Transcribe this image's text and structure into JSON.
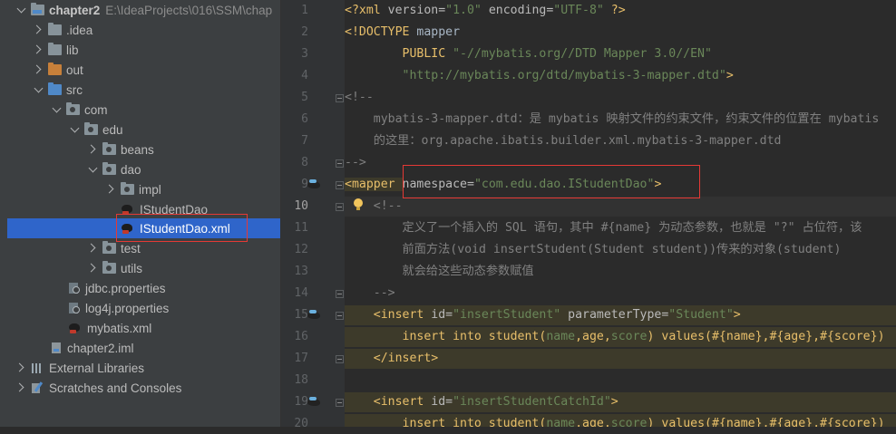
{
  "project_tree": {
    "root": {
      "name": "chapter2",
      "path": "E:\\IdeaProjects\\016\\SSM\\chap"
    },
    "items": [
      {
        "label": ".idea"
      },
      {
        "label": "lib"
      },
      {
        "label": "out"
      },
      {
        "label": "src"
      },
      {
        "label": "com"
      },
      {
        "label": "edu"
      },
      {
        "label": "beans"
      },
      {
        "label": "dao"
      },
      {
        "label": "impl"
      },
      {
        "label": "IStudentDao"
      },
      {
        "label": "IStudentDao.xml"
      },
      {
        "label": "test"
      },
      {
        "label": "utils"
      },
      {
        "label": "jdbc.properties"
      },
      {
        "label": "log4j.properties"
      },
      {
        "label": "mybatis.xml"
      },
      {
        "label": "chapter2.iml"
      },
      {
        "label": "External Libraries"
      },
      {
        "label": "Scratches and Consoles"
      }
    ]
  },
  "editor": {
    "line_numbers": [
      "1",
      "2",
      "3",
      "4",
      "5",
      "6",
      "7",
      "8",
      "9",
      "10",
      "11",
      "12",
      "13",
      "14",
      "15",
      "16",
      "17",
      "18",
      "19",
      "20"
    ],
    "current_line": "10",
    "code": {
      "l1a": "<?xml ",
      "l1b": "version=",
      "l1c": "\"1.0\"",
      "l1d": " encoding=",
      "l1e": "\"UTF-8\"",
      "l1f": " ?>",
      "l2a": "<!DOCTYPE ",
      "l2b": "mapper",
      "l3a": "        PUBLIC ",
      "l3b": "\"-//mybatis.org//DTD Mapper 3.0//EN\"",
      "l4a": "        ",
      "l4b": "\"http://mybatis.org/dtd/mybatis-3-mapper.dtd\"",
      "l4c": ">",
      "l5": "<!--",
      "l6": "    mybatis-3-mapper.dtd：是 mybatis 映射文件的约束文件，约束文件的位置在 mybatis",
      "l7": "    的这里：org.apache.ibatis.builder.xml.mybatis-3-mapper.dtd",
      "l8": "-->",
      "l9a": "<mapper ",
      "l9b": "namespace=",
      "l9c": "\"com.edu.dao.IStudentDao\"",
      "l9d": ">",
      "l10": "    <!--",
      "l11": "        定义了一个插入的 SQL 语句，其中 #{name} 为动态参数，也就是 \"?\" 占位符，该",
      "l12": "        前面方法(void insertStudent(Student student))传来的对象(student)",
      "l13": "        就会给这些动态参数赋值",
      "l14": "    -->",
      "l15a": "    <insert ",
      "l15b": "id=",
      "l15c": "\"insertStudent\"",
      "l15d": " parameterType=",
      "l15e": "\"Student\"",
      "l15f": ">",
      "l16a": "        insert into student(",
      "l16b": "name",
      "l16c": ",age,",
      "l16d": "score",
      "l16e": ") ",
      "l16f": "values",
      "l16g": "(#{name},#{age},#{score})",
      "l17": "    </insert>",
      "l19a": "    <insert ",
      "l19b": "id=",
      "l19c": "\"insertStudentCatchId\"",
      "l19d": ">",
      "l20a": "        insert into student(",
      "l20b": "name",
      "l20c": ",age,",
      "l20d": "score",
      "l20e": ") ",
      "l20f": "values",
      "l20g": "(#{name},#{age},#{score})"
    }
  },
  "colors": {
    "selection": "#2f65ca",
    "annotation_outline": "#e53935",
    "tag": "#e8bf6a",
    "string": "#6a8759",
    "comment": "#808080"
  }
}
